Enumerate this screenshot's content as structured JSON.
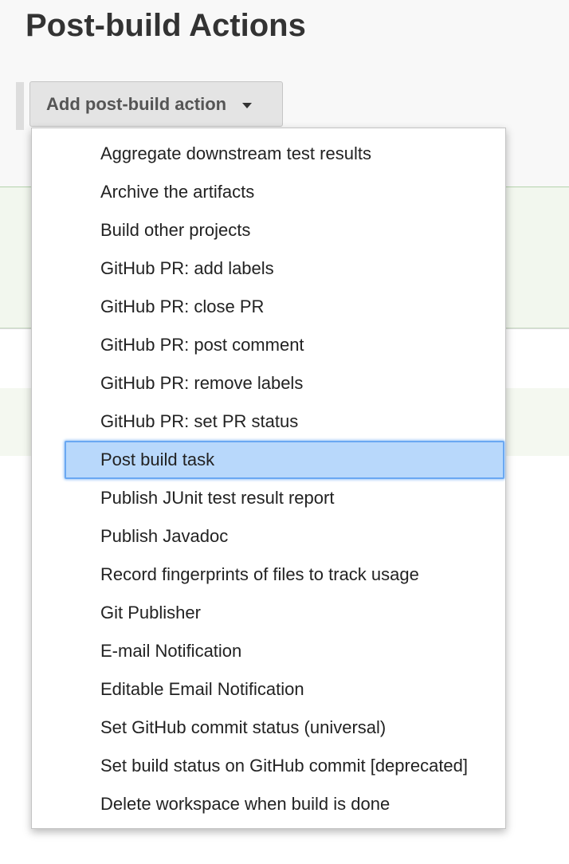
{
  "section": {
    "title": "Post-build Actions"
  },
  "add_button": {
    "label": "Add post-build action",
    "icon": "caret-down-icon"
  },
  "menu": {
    "highlighted_index": 8,
    "highlight_color": "#b8d8fb",
    "items": [
      {
        "label": "Aggregate downstream test results"
      },
      {
        "label": "Archive the artifacts"
      },
      {
        "label": "Build other projects"
      },
      {
        "label": "GitHub PR: add labels"
      },
      {
        "label": "GitHub PR: close PR"
      },
      {
        "label": "GitHub PR: post comment"
      },
      {
        "label": "GitHub PR: remove labels"
      },
      {
        "label": "GitHub PR: set PR status"
      },
      {
        "label": "Post build task"
      },
      {
        "label": "Publish JUnit test result report"
      },
      {
        "label": "Publish Javadoc"
      },
      {
        "label": "Record fingerprints of files to track usage"
      },
      {
        "label": "Git Publisher"
      },
      {
        "label": "E-mail Notification"
      },
      {
        "label": "Editable Email Notification"
      },
      {
        "label": "Set GitHub commit status (universal)"
      },
      {
        "label": "Set build status on GitHub commit [deprecated]"
      },
      {
        "label": "Delete workspace when build is done"
      }
    ]
  }
}
